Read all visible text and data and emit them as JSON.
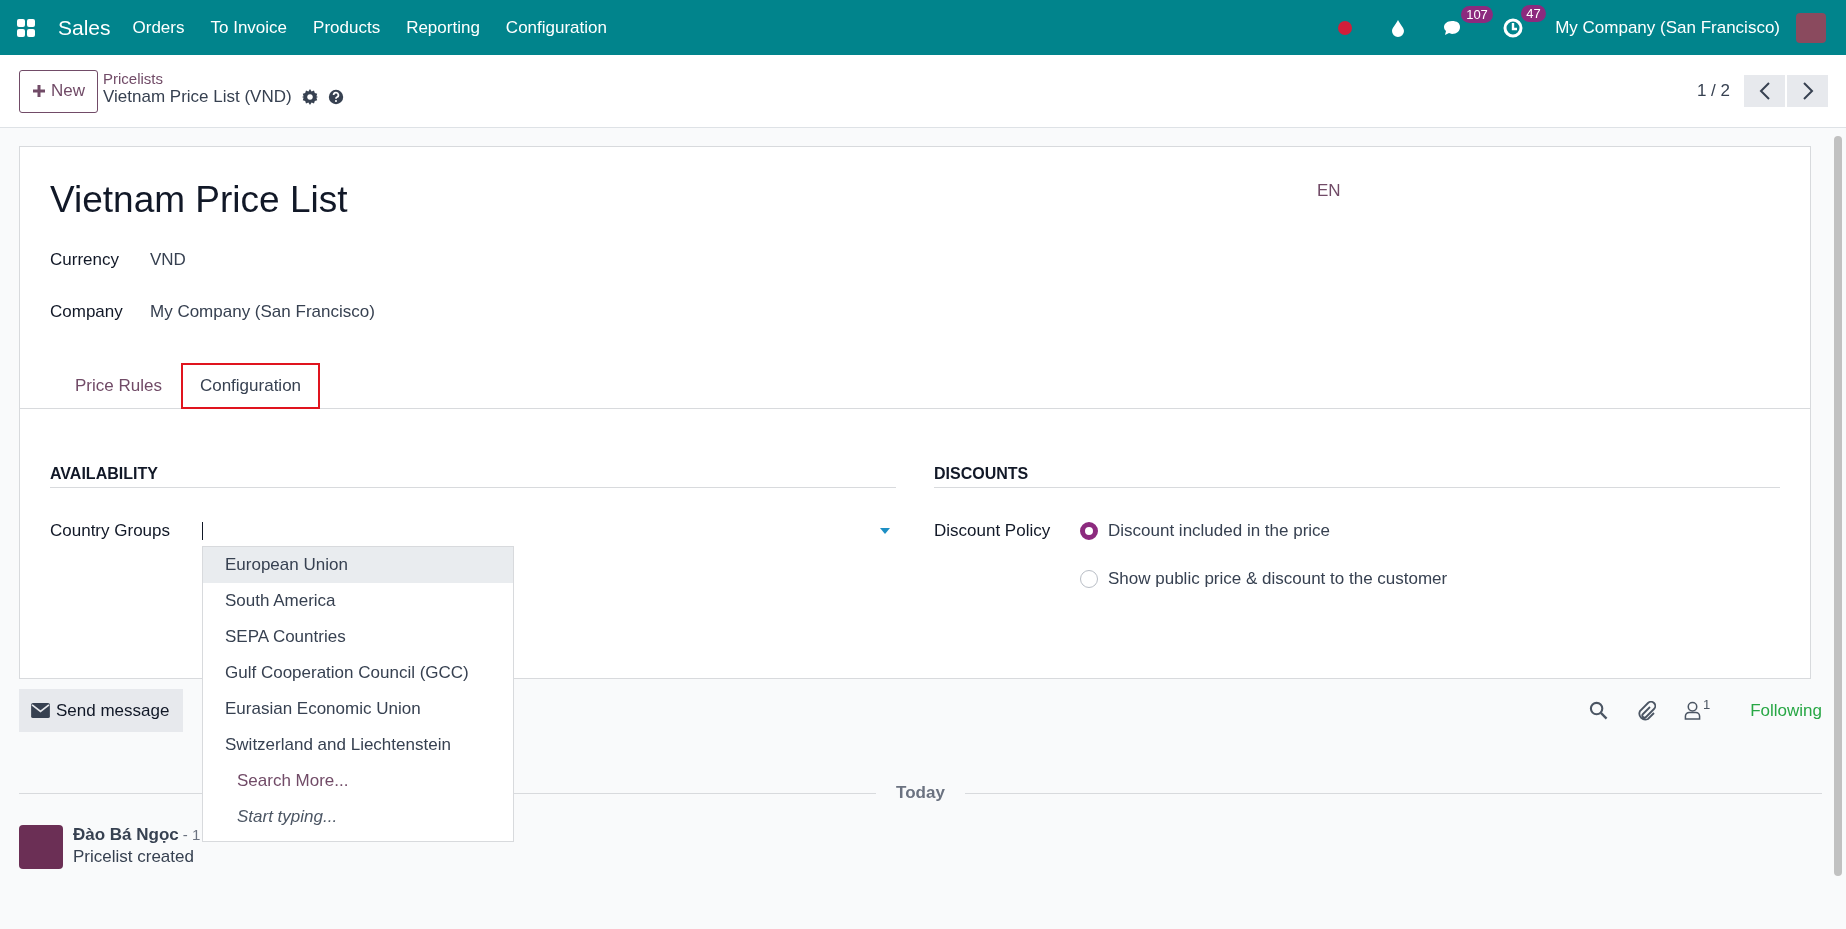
{
  "navbar": {
    "app": "Sales",
    "menu": [
      "Orders",
      "To Invoice",
      "Products",
      "Reporting",
      "Configuration"
    ],
    "messages_count": "107",
    "activities_count": "47",
    "company": "My Company (San Francisco)"
  },
  "control_panel": {
    "new_button": "New",
    "breadcrumb": "Pricelists",
    "record": "Vietnam Price List (VND)",
    "pager": "1 / 2"
  },
  "form": {
    "title": "Vietnam Price List",
    "language": "EN",
    "fields": [
      {
        "label": "Currency",
        "value": "VND"
      },
      {
        "label": "Company",
        "value": "My Company (San Francisco)"
      }
    ],
    "tabs": [
      {
        "label": "Price Rules",
        "selected": false
      },
      {
        "label": "Configuration",
        "selected": true
      }
    ],
    "availability": {
      "heading": "AVAILABILITY",
      "field_label": "Country Groups"
    },
    "discounts": {
      "heading": "DISCOUNTS",
      "field_label": "Discount Policy",
      "options": [
        {
          "label": "Discount included in the price",
          "selected": true
        },
        {
          "label": "Show public price & discount to the customer",
          "selected": false
        }
      ]
    }
  },
  "dropdown": {
    "items": [
      {
        "label": "European Union",
        "selected": true
      },
      {
        "label": "South America",
        "selected": false
      },
      {
        "label": "SEPA Countries",
        "selected": false
      },
      {
        "label": "Gulf Cooperation Council (GCC)",
        "selected": false
      },
      {
        "label": "Eurasian Economic Union",
        "selected": false
      },
      {
        "label": "Switzerland and Liechtenstein",
        "selected": false
      }
    ],
    "search_more": "Search More...",
    "hint": "Start typing..."
  },
  "chatter": {
    "send_message": "Send message",
    "followers_count": "1",
    "follow_status": "Following",
    "date_divider": "Today",
    "messages": [
      {
        "author": "Đào Bá Ngọc",
        "meta": "- 1",
        "body": "Pricelist created"
      }
    ]
  }
}
